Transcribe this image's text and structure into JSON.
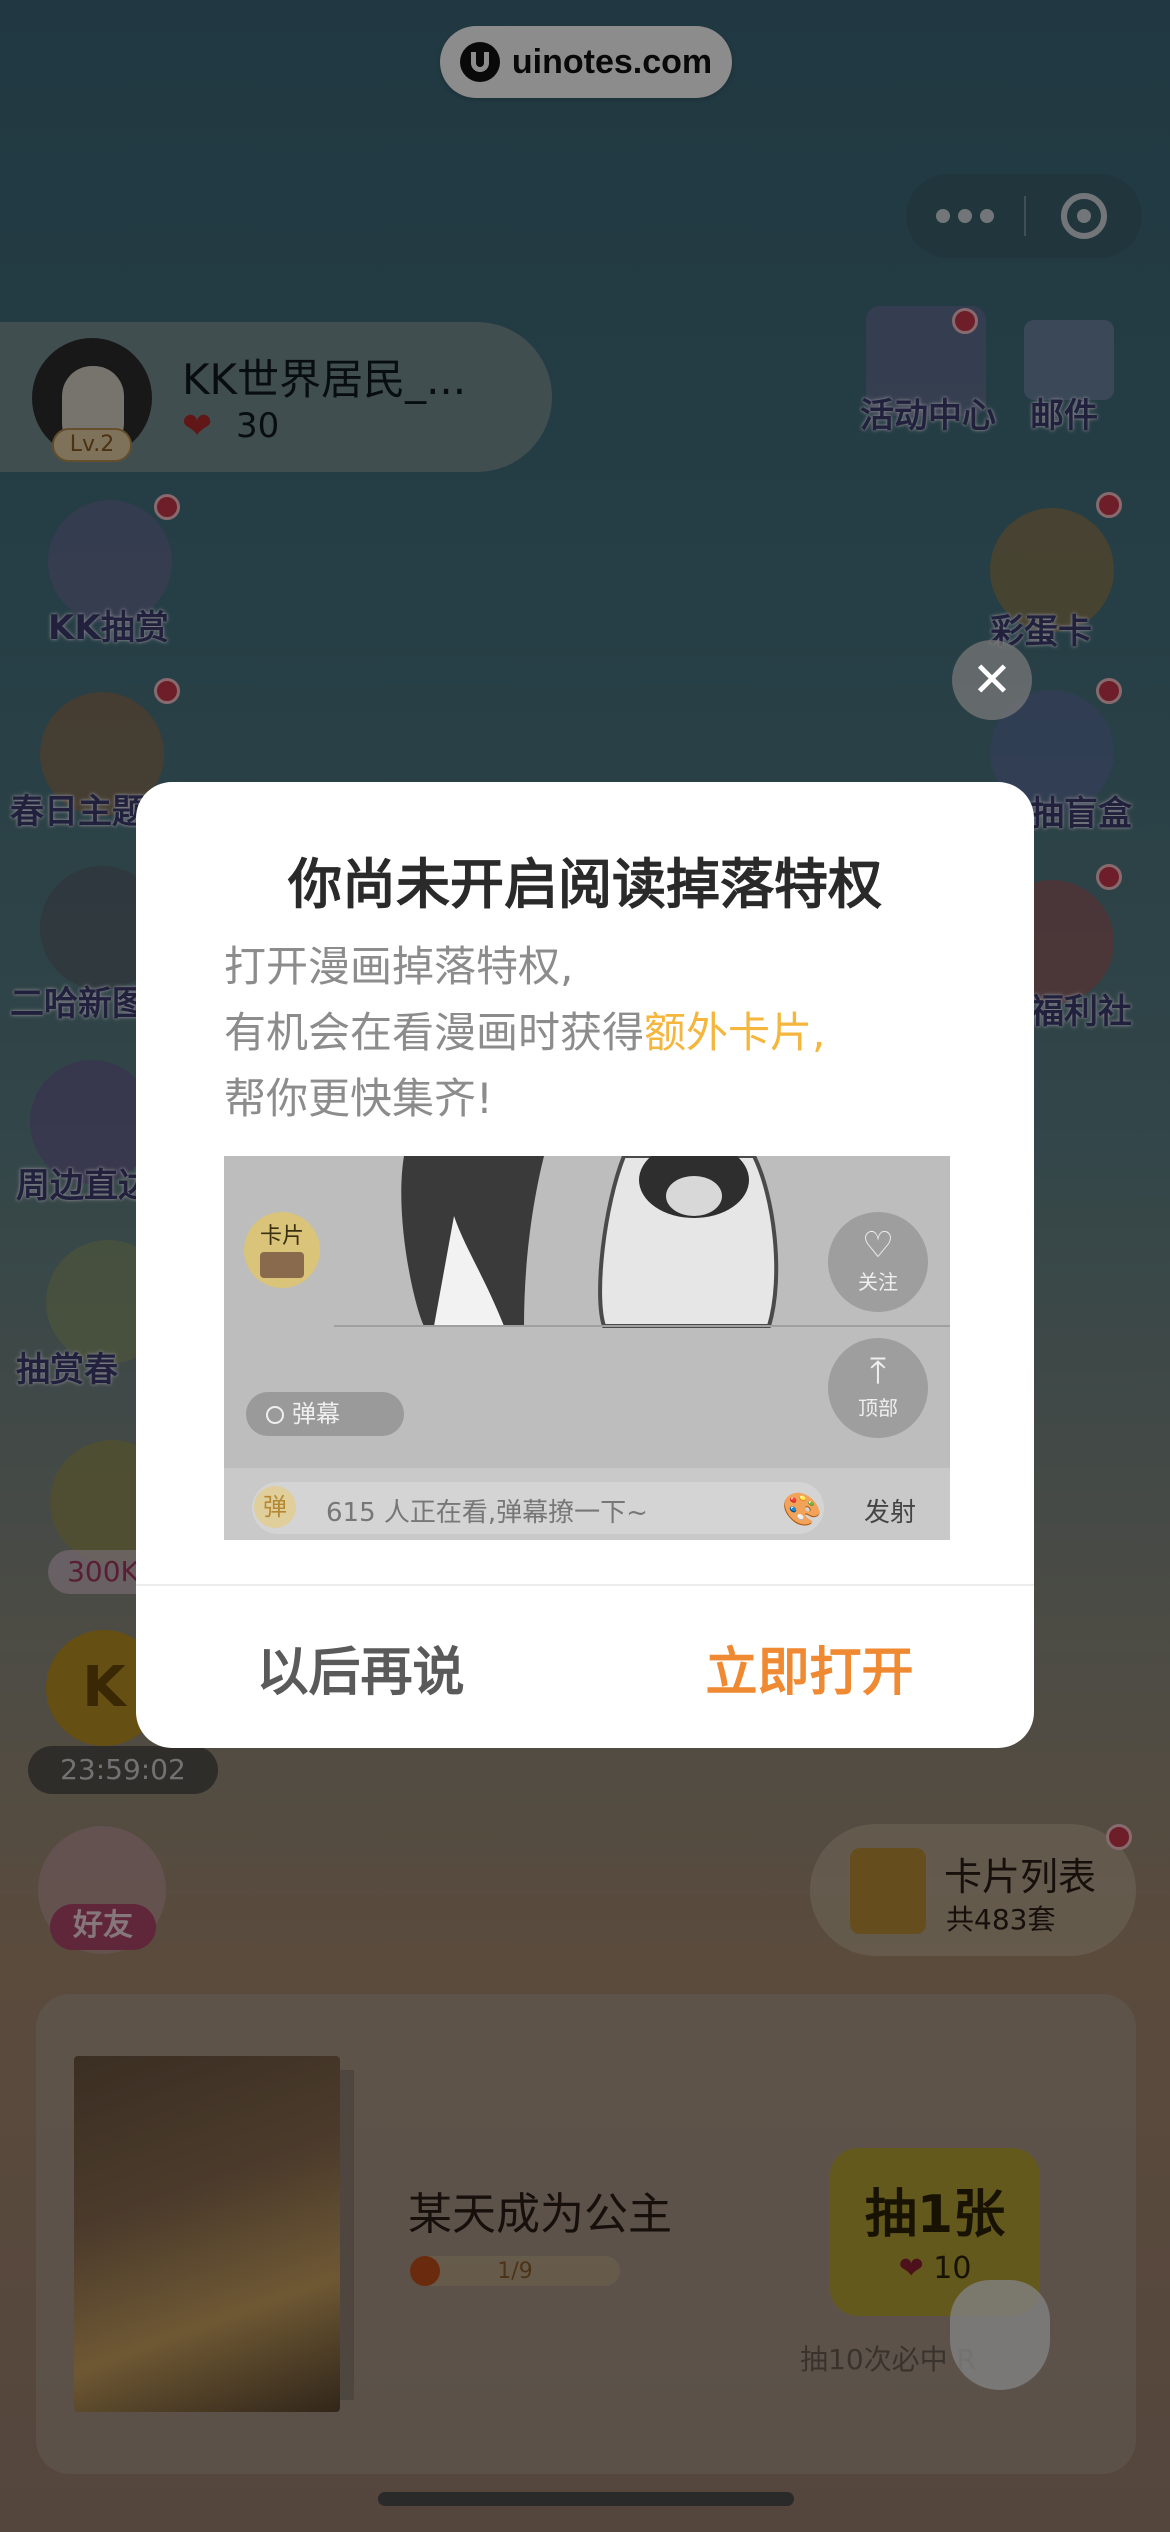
{
  "watermark": {
    "text": "uinotes.com"
  },
  "user": {
    "name": "KK世界居民_...",
    "level": "Lv.2",
    "hearts": "30"
  },
  "top_right": {
    "activity_label": "活动中心",
    "mail_label": "邮件"
  },
  "left_icons": [
    {
      "label": "KK抽赏"
    },
    {
      "label": "春日主题"
    },
    {
      "label": "二哈新图"
    },
    {
      "label": "周边直达"
    },
    {
      "label": "抽赏春"
    },
    {
      "label": "300K"
    }
  ],
  "right_icons": [
    {
      "label": "彩蛋卡"
    },
    {
      "label": "抽盲盒"
    },
    {
      "label": "福利社"
    }
  ],
  "timer": "23:59:02",
  "coin_symbol": "K",
  "friend_label": "好友",
  "cards_list": {
    "title": "卡片列表",
    "subtitle": "共483套"
  },
  "book": {
    "title": "某天成为公主",
    "progress": "1/9",
    "progress_fraction": 0.11
  },
  "draw": {
    "label": "抽1张",
    "cost": "10",
    "note": "抽10次必中 R"
  },
  "dialog": {
    "title": "你尚未开启阅读掉落特权",
    "line1": "打开漫画掉落特权,",
    "line2_prefix": "有机会在看漫画时获得",
    "line2_highlight": "额外卡片,",
    "line3": "帮你更快集齐!",
    "preview": {
      "card_badge": "卡片",
      "follow_label": "关注",
      "top_label": "顶部",
      "danmu_label": "弹幕",
      "danmu_chip": "弹",
      "input_placeholder": "615 人正在看,弹幕撩一下~",
      "send_label": "发射"
    },
    "later_button": "以后再说",
    "open_button": "立即打开"
  },
  "colors": {
    "highlight": "#f4b63c",
    "primary_action": "#ef8a33",
    "badge_red": "#c9374c"
  }
}
